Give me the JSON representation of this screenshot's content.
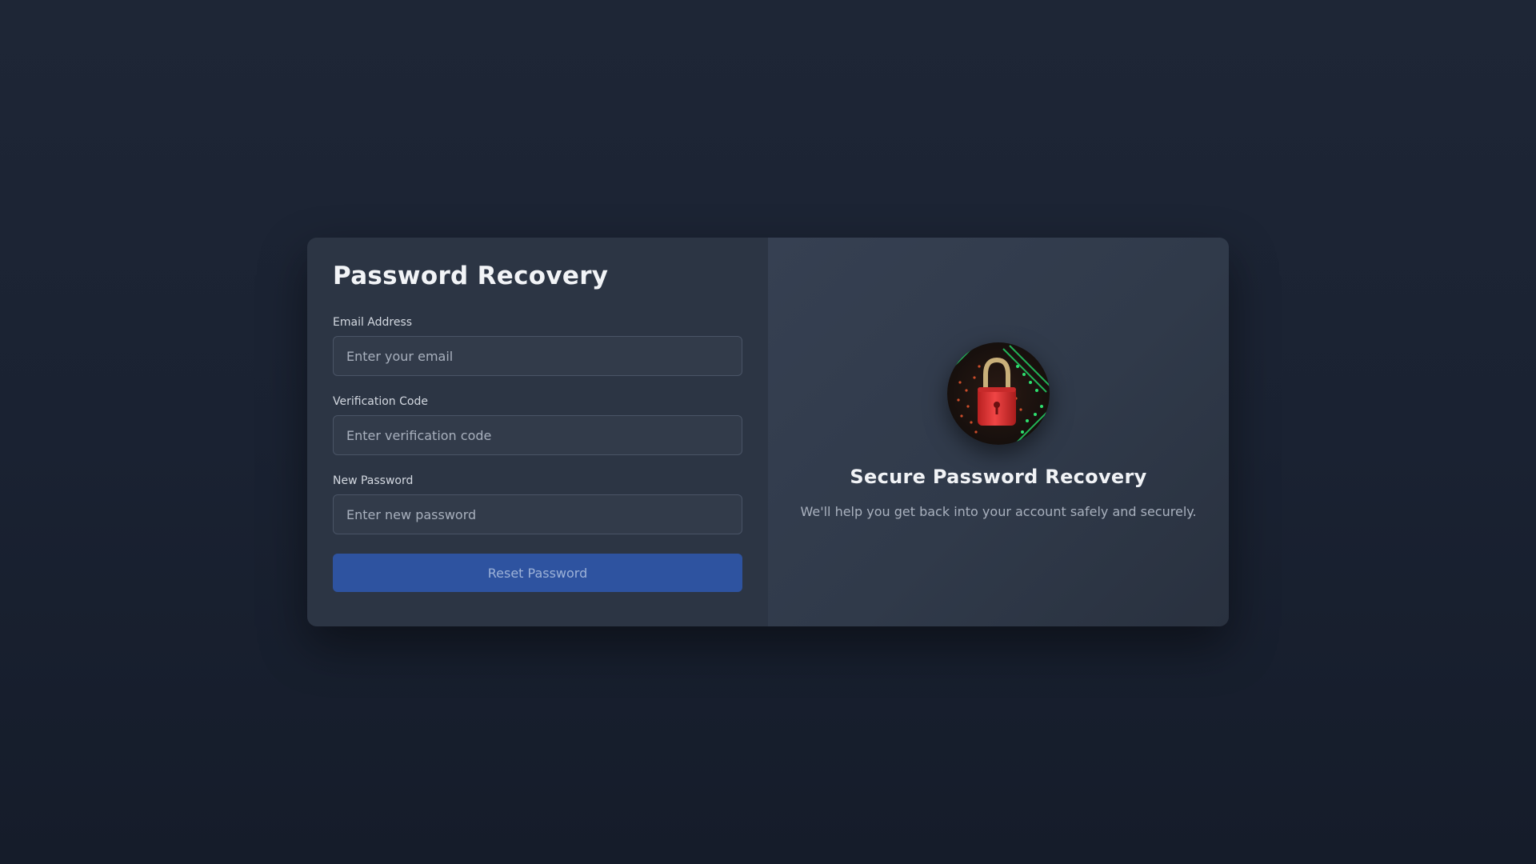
{
  "page": {
    "title": "Password Recovery"
  },
  "form": {
    "email": {
      "label": "Email Address",
      "placeholder": "Enter your email",
      "value": ""
    },
    "code": {
      "label": "Verification Code",
      "placeholder": "Enter verification code",
      "value": ""
    },
    "password": {
      "label": "New Password",
      "placeholder": "Enter new password",
      "value": ""
    },
    "submit_label": "Reset Password"
  },
  "info": {
    "image_icon": "padlock-on-circuit-icon",
    "title": "Secure Password Recovery",
    "subtitle": "We'll help you get back into your account safely and securely."
  },
  "colors": {
    "background": "#1b2231",
    "panel_left": "#2c3544",
    "panel_right": "#333d4d",
    "accent_button": "#2e53a0",
    "padlock": "#e03a3a",
    "circuit": "#22c55e"
  }
}
